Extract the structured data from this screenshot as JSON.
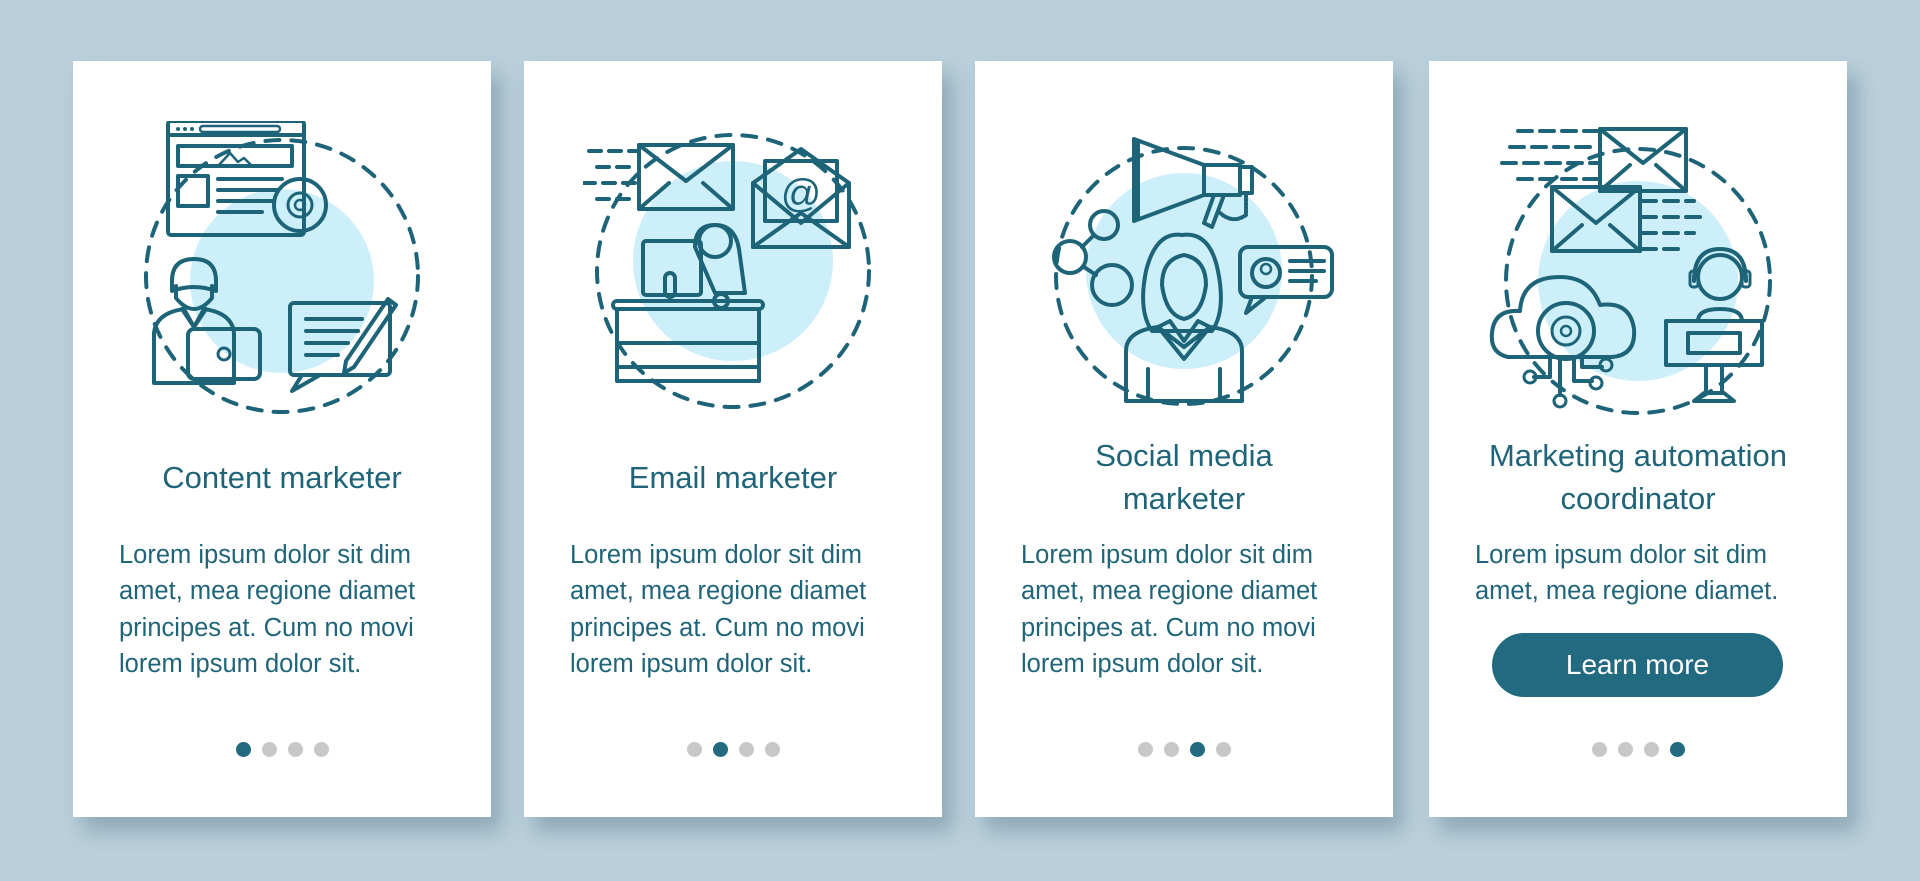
{
  "colors": {
    "background": "#b9cfdb",
    "card": "#ffffff",
    "text": "#1f6478",
    "accent": "#226a80",
    "dot_inactive": "#c8c8c8",
    "illustration_orange": "#f4a86a",
    "illustration_blue": "#7bbcef",
    "illustration_light": "#cdeffa"
  },
  "cards": [
    {
      "title": "Content marketer",
      "body": "Lorem ipsum dolor sit dim\namet, mea regione diamet\nprincipes at. Cum no movi\nlorem ipsum dolor sit.",
      "icon": "content-marketer-illustration",
      "page_index": 1,
      "page_count": 4
    },
    {
      "title": "Email marketer",
      "body": "Lorem ipsum dolor sit dim\namet, mea regione diamet\nprincipes at. Cum no movi\nlorem ipsum dolor sit.",
      "icon": "email-marketer-illustration",
      "page_index": 2,
      "page_count": 4
    },
    {
      "title": "Social media\nmarketer",
      "title_lines": [
        "Social media",
        "marketer"
      ],
      "body": "Lorem ipsum dolor sit dim\namet, mea regione diamet\nprincipes at. Cum no movi\nlorem ipsum dolor sit.",
      "icon": "social-media-marketer-illustration",
      "page_index": 3,
      "page_count": 4
    },
    {
      "title": "Marketing automation\ncoordinator",
      "title_lines": [
        "Marketing automation",
        "coordinator"
      ],
      "body": "Lorem ipsum dolor sit dim\namet, mea regione diamet.",
      "icon": "marketing-automation-illustration",
      "button_label": "Learn more",
      "page_index": 4,
      "page_count": 4
    }
  ]
}
